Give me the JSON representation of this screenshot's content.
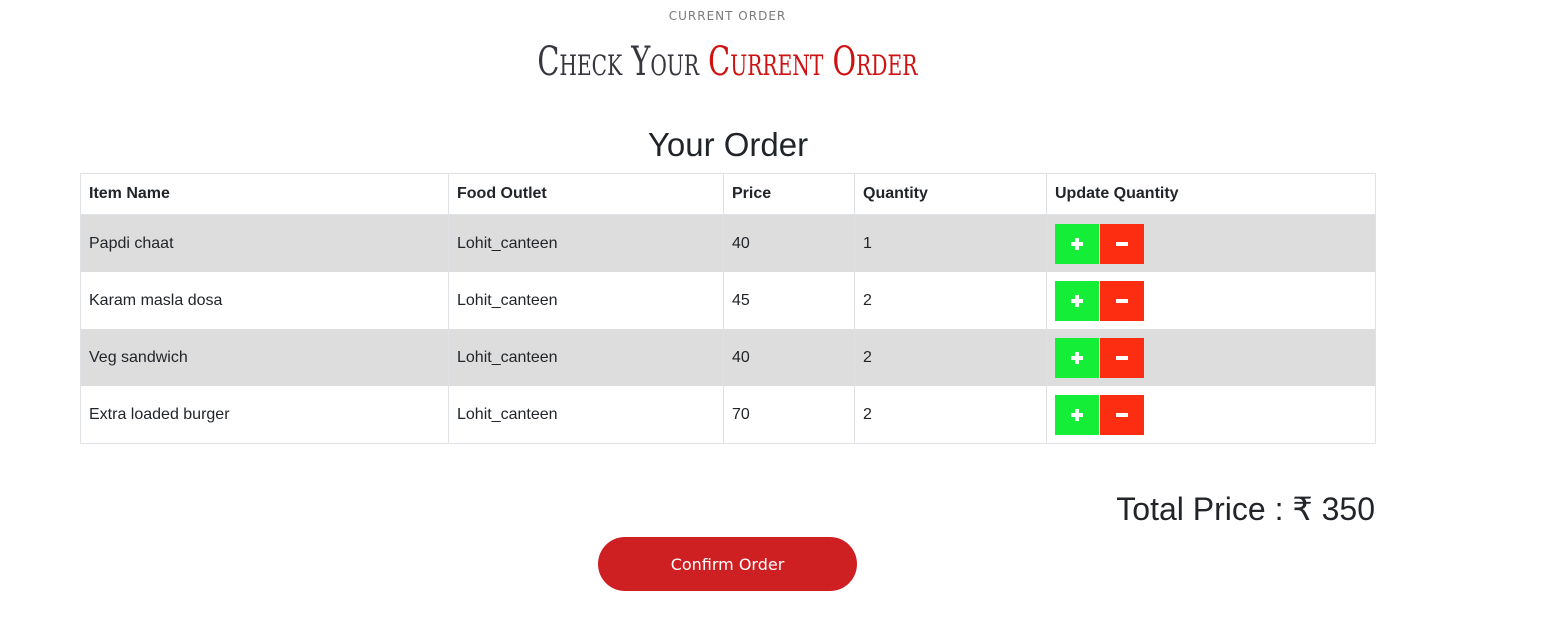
{
  "header": {
    "eyebrow": "CURRENT ORDER",
    "title_dark": "Check Your",
    "title_red": "Current Order"
  },
  "order": {
    "title": "Your Order",
    "columns": [
      "Item Name",
      "Food Outlet",
      "Price",
      "Quantity",
      "Update Quantity"
    ],
    "rows": [
      {
        "item": "Papdi chaat",
        "outlet": "Lohit_canteen",
        "price": "40",
        "quantity": "1"
      },
      {
        "item": "Karam masla dosa",
        "outlet": "Lohit_canteen",
        "price": "45",
        "quantity": "2"
      },
      {
        "item": "Veg sandwich",
        "outlet": "Lohit_canteen",
        "price": "40",
        "quantity": "2"
      },
      {
        "item": "Extra loaded burger",
        "outlet": "Lohit_canteen",
        "price": "70",
        "quantity": "2"
      }
    ],
    "update_buttons": {
      "increase_icon": "plus-icon",
      "decrease_icon": "minus-icon"
    }
  },
  "summary": {
    "total_label": "Total Price : ₹ 350"
  },
  "actions": {
    "confirm_label": "Confirm Order"
  },
  "colors": {
    "accent_red": "#ce1212",
    "confirm_button": "#ce2023",
    "increase_button": "#15ee36",
    "decrease_button": "#fc2d11",
    "striped_row": "#dddddd"
  }
}
